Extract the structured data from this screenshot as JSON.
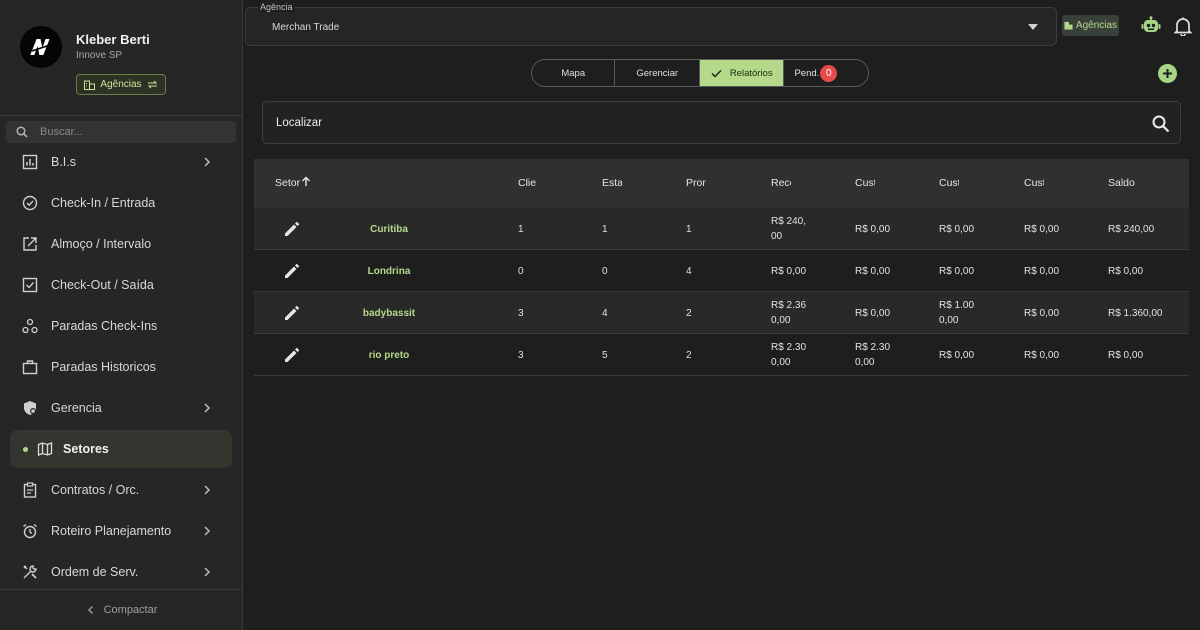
{
  "profile": {
    "name": "Kleber Berti",
    "org": "Innove SP",
    "agency_chip_label": "Agências"
  },
  "sidebar": {
    "search_placeholder": "Buscar...",
    "items": [
      {
        "label": "B.I.s",
        "icon": "chart-icon",
        "chevron": true
      },
      {
        "label": "Check-In / Entrada",
        "icon": "check-circle-icon",
        "chevron": false
      },
      {
        "label": "Almoço / Intervalo",
        "icon": "external-link-icon",
        "chevron": false
      },
      {
        "label": "Check-Out / Saída",
        "icon": "checkbox-icon",
        "chevron": false
      },
      {
        "label": "Paradas Check-Ins",
        "icon": "graph-nodes-icon",
        "chevron": false
      },
      {
        "label": "Paradas Historicos",
        "icon": "briefcase-icon",
        "chevron": false
      },
      {
        "label": "Gerencia",
        "icon": "shield-icon",
        "chevron": true
      },
      {
        "label": "Setores",
        "icon": "map-icon",
        "chevron": false,
        "active": true
      },
      {
        "label": "Contratos / Orc.",
        "icon": "clipboard-icon",
        "chevron": true
      },
      {
        "label": "Roteiro Planejamento",
        "icon": "alarm-clock-icon",
        "chevron": true
      },
      {
        "label": "Ordem de Serv.",
        "icon": "tools-icon",
        "chevron": true
      }
    ],
    "footer_label": "Compactar"
  },
  "topbar": {
    "select_legend": "Agência",
    "select_value": "Merchan Trade",
    "agencias_label": "Agências"
  },
  "tabs": {
    "mapa": "Mapa",
    "gerenciar": "Gerenciar",
    "relatorios": "Relatórios",
    "pend": "Pend.",
    "pend_count": "0",
    "active": "Relatórios"
  },
  "find": {
    "label": "Localizar"
  },
  "table": {
    "columns": [
      "Setor",
      "Clie",
      "Esta",
      "Pror",
      "Rece",
      "Cust",
      "Cust",
      "Cust",
      "Saldo"
    ],
    "sort_column": "Setor",
    "rows": [
      {
        "setor": "Curitiba",
        "c1": "1",
        "c2": "1",
        "c3": "1",
        "receita": [
          "R$ 240,",
          "00"
        ],
        "cust1": [
          "R$ 0,00"
        ],
        "cust2": [
          "R$ 0,00"
        ],
        "cust3": [
          "R$ 0,00"
        ],
        "saldo": "R$ 240,00"
      },
      {
        "setor": "Londrina",
        "c1": "0",
        "c2": "0",
        "c3": "4",
        "receita": [
          "R$ 0,00"
        ],
        "cust1": [
          "R$ 0,00"
        ],
        "cust2": [
          "R$ 0,00"
        ],
        "cust3": [
          "R$ 0,00"
        ],
        "saldo": "R$ 0,00"
      },
      {
        "setor": "badybassit",
        "c1": "3",
        "c2": "4",
        "c3": "2",
        "receita": [
          "R$ 2.36",
          "0,00"
        ],
        "cust1": [
          "R$ 0,00"
        ],
        "cust2": [
          "R$ 1.00",
          "0,00"
        ],
        "cust3": [
          "R$ 0,00"
        ],
        "saldo": "R$ 1.360,00"
      },
      {
        "setor": "rio preto",
        "c1": "3",
        "c2": "5",
        "c3": "2",
        "receita": [
          "R$ 2.30",
          "0,00"
        ],
        "cust1": [
          "R$ 2.30",
          "0,00"
        ],
        "cust2": [
          "R$ 0,00"
        ],
        "cust3": [
          "R$ 0,00"
        ],
        "saldo": "R$ 0,00"
      }
    ]
  },
  "colors": {
    "accent": "#b5d98a",
    "background": "#1e1e1f",
    "sidebar": "#262627",
    "badge": "#e64a4a"
  }
}
